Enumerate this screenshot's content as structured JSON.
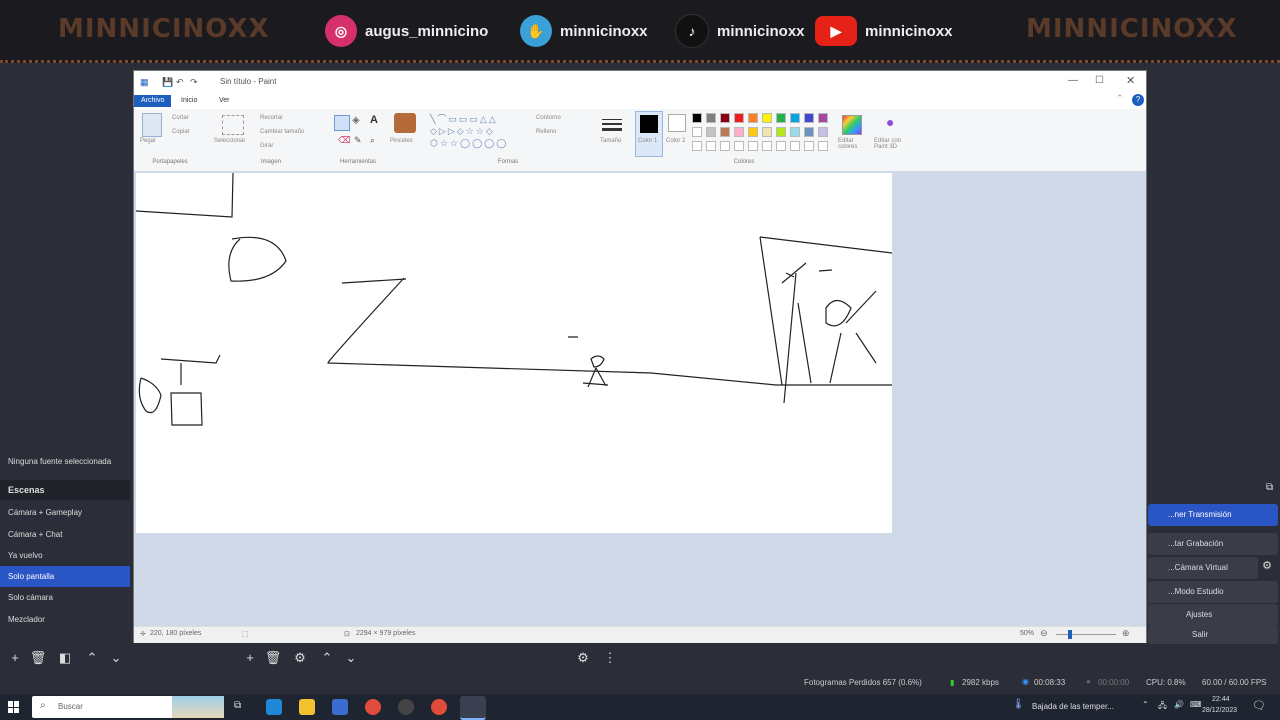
{
  "banner": {
    "brand_left": "MINNICINOXX",
    "brand_right": "MINNICINOXX",
    "socials": [
      {
        "icon": "instagram-icon",
        "handle": "augus_minnicino",
        "color": "#d6306b"
      },
      {
        "icon": "handshake-icon",
        "handle": "minnicinoxx",
        "color": "#3aa0d8"
      },
      {
        "icon": "tiktok-icon",
        "handle": "minnicinoxx",
        "color": "#111111"
      },
      {
        "icon": "youtube-icon",
        "handle": "minnicinoxx",
        "color": "#e62117"
      }
    ]
  },
  "obs": {
    "no_source": "Ninguna fuente seleccionada",
    "scenes_title": "Escenas",
    "scenes": [
      "Cámara + Gameplay",
      "Cámara + Chat",
      "Ya vuelvo",
      "Solo pantalla",
      "Solo cámara",
      "Mezclador"
    ],
    "selected_scene": 3,
    "controls": [
      "...ner Transmisión",
      "...tar Grabación",
      "...Cámara Virtual",
      "...Modo Estudio",
      "Ajustes",
      "Salir"
    ],
    "status": {
      "dropped": "Fotogramas Perdidos 657 (0.6%)",
      "bitrate": "2982 kbps",
      "live_time": "00:08:33",
      "rec_time": "00:00:00",
      "cpu": "CPU: 0.8%",
      "fps": "60.00 / 60.00 FPS"
    }
  },
  "paint": {
    "title": "Sin título - Paint",
    "tabs": [
      "Archivo",
      "Inicio",
      "Ver"
    ],
    "active_tab": 0,
    "groups": {
      "clipboard": "Portapapeles",
      "image": "Imagen",
      "tools": "Herramientas",
      "shapes": "Formas",
      "colors": "Colores"
    },
    "ribbon_items": {
      "paste": "Pegar",
      "cut": "Cortar",
      "copy": "Copiar",
      "select": "Seleccionar",
      "crop": "Recortar",
      "resize": "Cambiar tamaño",
      "rotate": "Girar",
      "brushes": "Pinceles",
      "outline": "Contorno",
      "fill": "Relleno",
      "size": "Tamaño",
      "color1": "Color 1",
      "color2": "Color 2",
      "edit_colors": "Editar colores",
      "paint3d": "Editar con Paint 3D"
    },
    "palette": [
      "#000000",
      "#7f7f7f",
      "#880015",
      "#ed1c24",
      "#ff7f27",
      "#fff200",
      "#22b14c",
      "#00a2e8",
      "#3f48cc",
      "#a349a4",
      "#ffffff",
      "#c3c3c3",
      "#b97a57",
      "#ffaec9",
      "#ffc90e",
      "#efe4b0",
      "#b5e61d",
      "#99d9ea",
      "#7092be",
      "#c8bfe7"
    ],
    "status": {
      "cursor": "220, 180 píxeles",
      "size": "2294 × 979 píxeles",
      "zoom": "50%"
    }
  },
  "taskbar": {
    "search_placeholder": "Buscar",
    "weather": "Bajada de las temper...",
    "time": "22:44",
    "date": "28/12/2023"
  }
}
